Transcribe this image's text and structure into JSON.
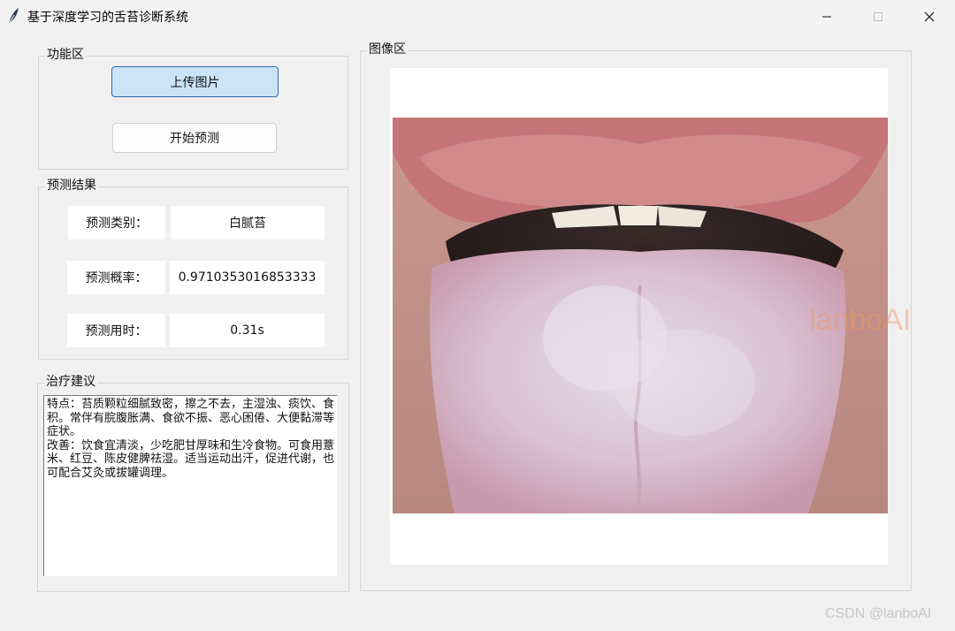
{
  "window": {
    "title": "基于深度学习的舌苔诊断系统",
    "controls": {
      "minimize": "—",
      "maximize": "☐",
      "close": "✕"
    }
  },
  "function_panel": {
    "label": "功能区",
    "upload_button": "上传图片",
    "predict_button": "开始预测"
  },
  "result_panel": {
    "label": "预测结果",
    "rows": [
      {
        "key": "预测类别：",
        "value": "白腻苔"
      },
      {
        "key": "预测概率：",
        "value": "0.9710353016853333"
      },
      {
        "key": "预测用时：",
        "value": "0.31s"
      }
    ]
  },
  "advice_panel": {
    "label": "治疗建议",
    "text": "特点：苔质颗粒细腻致密，擦之不去，主湿浊、痰饮、食积。常伴有脘腹胀满、食欲不振、恶心困倦、大便黏滞等症状。\n改善：饮食宜清淡，少吃肥甘厚味和生冷食物。可食用薏米、红豆、陈皮健脾祛湿。适当运动出汗，促进代谢，也可配合艾灸或拔罐调理。"
  },
  "image_panel": {
    "label": "图像区",
    "overlay_watermark": "lanboAI"
  },
  "footer": {
    "watermark": "CSDN @lanboAI"
  },
  "icons": {
    "app_icon": "feather-icon"
  }
}
